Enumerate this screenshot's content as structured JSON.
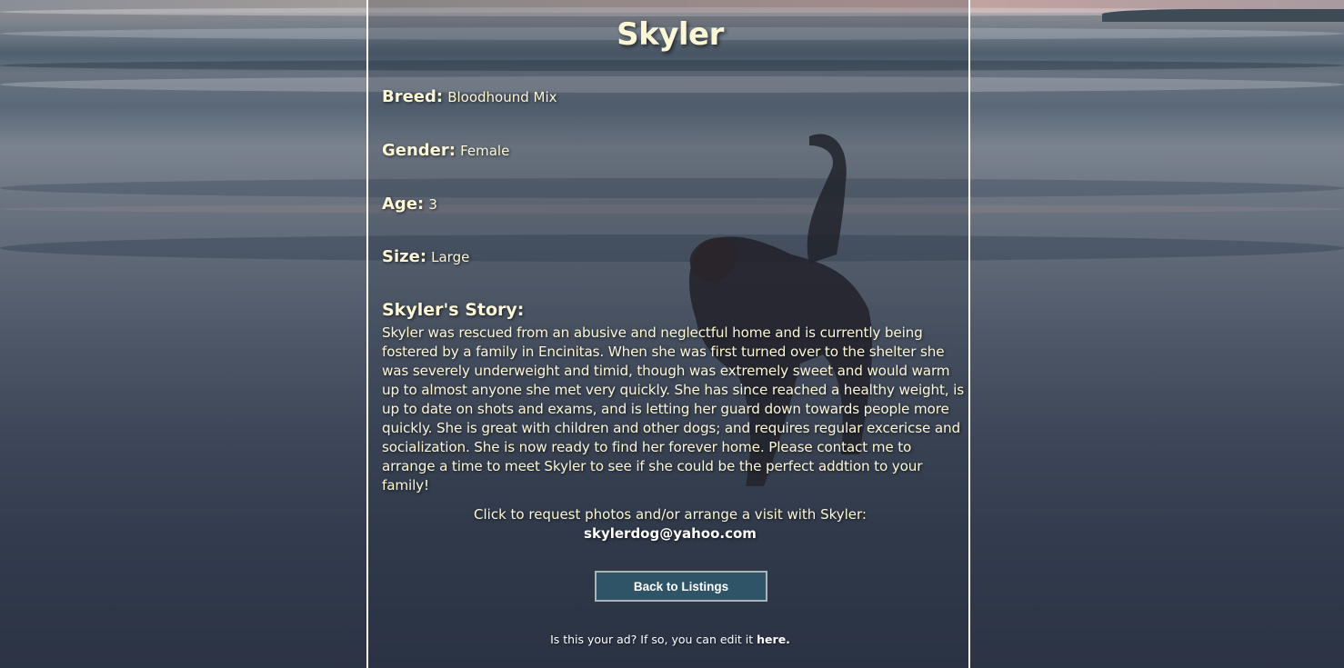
{
  "listing": {
    "name": "Skyler",
    "breed_label": "Breed:",
    "breed": "Bloodhound Mix",
    "gender_label": "Gender:",
    "gender": "Female",
    "age_label": "Age:",
    "age": "3",
    "size_label": "Size:",
    "size": "Large",
    "story_heading": "Skyler's Story:",
    "story": "Skyler was rescued from an abusive and neglectful home and is currently being fostered by a family in Encinitas. When she was first turned over to the shelter she was severely underweight and timid, though was extremely sweet and would warm up to almost anyone she met very quickly. She has since reached a healthy weight, is up to date on shots and exams, and is letting her guard down towards people more quickly. She is great with children and other dogs; and requires regular excericse and socialization. She is now ready to find her forever home. Please contact me to arrange a time to meet Skyler to see if she could be the perfect addtion to your family!"
  },
  "contact": {
    "prompt": "Click to request photos and/or arrange a visit with Skyler:",
    "email": "skylerdog@yahoo.com"
  },
  "actions": {
    "back_label": "Back to Listings"
  },
  "footer": {
    "note": "Is this your ad? If so, you can edit it ",
    "edit_link": "here."
  },
  "colors": {
    "text": "#fbf6d6",
    "button_bg": "#2f5468",
    "panel_border": "#ffffff"
  }
}
